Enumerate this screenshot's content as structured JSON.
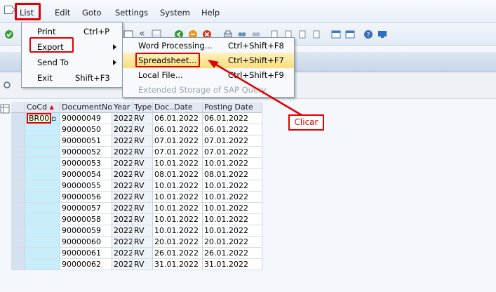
{
  "menubar": {
    "items": [
      {
        "label": "List",
        "hotkey_index": 0
      },
      {
        "label": "Edit"
      },
      {
        "label": "Goto"
      },
      {
        "label": "Settings"
      },
      {
        "label": "System"
      },
      {
        "label": "Help"
      }
    ]
  },
  "list_menu": {
    "items": [
      {
        "label": "Print",
        "accel": "Ctrl+P"
      },
      {
        "label": "Export",
        "accel": ""
      },
      {
        "label": "Send To",
        "accel": ""
      },
      {
        "label": "Exit",
        "accel": "Shift+F3"
      }
    ]
  },
  "export_menu": {
    "items": [
      {
        "label": "Word Processing...",
        "accel": "Ctrl+Shift+F8"
      },
      {
        "label": "Spreadsheet...",
        "accel": "Ctrl+Shift+F7"
      },
      {
        "label": "Local File...",
        "accel": "Ctrl+Shift+F9"
      },
      {
        "label": "Extended Storage of SAP Query",
        "accel": ""
      }
    ]
  },
  "callout": {
    "label": "Clicar"
  },
  "grid": {
    "headers": [
      "CoCd",
      "DocumentNo",
      "Year",
      "Type",
      "Doc..Date",
      "Posting Date"
    ],
    "first_cocd": "BR00",
    "rows": [
      [
        "90000049",
        "2022",
        "RV",
        "06.01.2022",
        "06.01.2022"
      ],
      [
        "90000050",
        "2022",
        "RV",
        "06.01.2022",
        "06.01.2022"
      ],
      [
        "90000051",
        "2022",
        "RV",
        "07.01.2022",
        "07.01.2022"
      ],
      [
        "90000052",
        "2022",
        "RV",
        "07.01.2022",
        "07.01.2022"
      ],
      [
        "90000053",
        "2022",
        "RV",
        "10.01.2022",
        "10.01.2022"
      ],
      [
        "90000054",
        "2022",
        "RV",
        "08.01.2022",
        "08.01.2022"
      ],
      [
        "90000055",
        "2022",
        "RV",
        "10.01.2022",
        "10.01.2022"
      ],
      [
        "90000056",
        "2022",
        "RV",
        "10.01.2022",
        "10.01.2022"
      ],
      [
        "90000057",
        "2022",
        "RV",
        "10.01.2022",
        "10.01.2022"
      ],
      [
        "90000058",
        "2022",
        "RV",
        "10.01.2022",
        "10.01.2022"
      ],
      [
        "90000059",
        "2022",
        "RV",
        "10.01.2022",
        "10.01.2022"
      ],
      [
        "90000060",
        "2022",
        "RV",
        "20.01.2022",
        "20.01.2022"
      ],
      [
        "90000061",
        "2022",
        "RV",
        "26.01.2022",
        "26.01.2022"
      ],
      [
        "90000062",
        "2022",
        "RV",
        "31.01.2022",
        "31.01.2022"
      ]
    ]
  },
  "colors": {
    "highlight": "#e00000",
    "cocd_column": "#c8eefb",
    "menu_hover": "#f9de7a"
  }
}
